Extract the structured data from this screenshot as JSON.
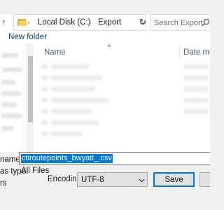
{
  "address_bar": {
    "breadcrumb": [
      "Local Disk (C:)",
      "Export"
    ],
    "separator": "›",
    "search_placeholder": "Search Export"
  },
  "toolbar": {
    "new_folder_label": "New folder"
  },
  "file_list": {
    "columns": [
      "Name",
      "Date modi"
    ]
  },
  "form": {
    "file_name_label": "name:",
    "file_name_value": "ctiroutepoints_bwyatt_.csv",
    "save_type_label": "as type:",
    "save_type_value": "All Files"
  },
  "actions": {
    "hide_folders_text": "rs",
    "encoding_label": "Encoding:",
    "encoding_value": "UTF-8",
    "save_label": "Save"
  },
  "colors": {
    "selection": "#0078d7",
    "folder": "#f3d06b",
    "button_face": "#e1e1e1"
  },
  "icons": [
    "up-arrow-icon",
    "folder-icon",
    "chevron-down-icon",
    "refresh-icon",
    "search-icon",
    "sort-arrow-icon"
  ]
}
